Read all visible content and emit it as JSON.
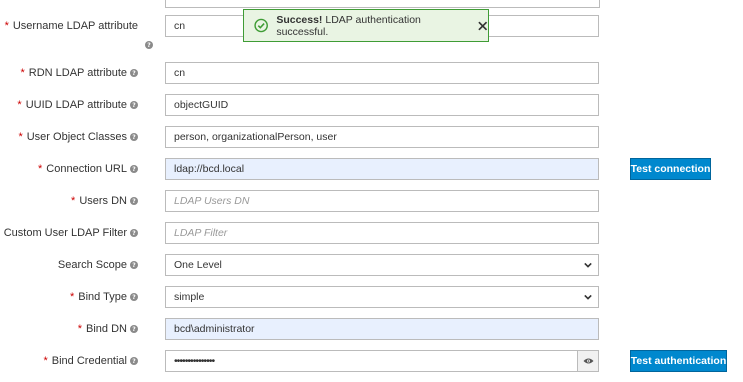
{
  "toast": {
    "title": "Success!",
    "message": "LDAP authentication successful."
  },
  "rows": [
    {
      "label": "Username LDAP attribute",
      "required": true,
      "value": "cn",
      "placeholder": ""
    },
    {
      "label": "RDN LDAP attribute",
      "required": true,
      "value": "cn",
      "placeholder": ""
    },
    {
      "label": "UUID LDAP attribute",
      "required": true,
      "value": "objectGUID",
      "placeholder": ""
    },
    {
      "label": "User Object Classes",
      "required": true,
      "value": "person, organizationalPerson, user",
      "placeholder": ""
    },
    {
      "label": "Connection URL",
      "required": true,
      "value": "ldap://bcd.local",
      "placeholder": ""
    },
    {
      "label": "Users DN",
      "required": true,
      "value": "",
      "placeholder": "LDAP Users DN"
    },
    {
      "label": "Custom User LDAP Filter",
      "required": false,
      "value": "",
      "placeholder": "LDAP Filter"
    },
    {
      "label": "Search Scope",
      "required": false,
      "value": "One Level",
      "placeholder": ""
    },
    {
      "label": "Bind Type",
      "required": true,
      "value": "simple",
      "placeholder": ""
    },
    {
      "label": "Bind DN",
      "required": true,
      "value": "bcd\\administrator",
      "placeholder": ""
    },
    {
      "label": "Bind Credential",
      "required": true,
      "value": "•••••••••••••••",
      "placeholder": ""
    }
  ],
  "buttons": {
    "test_connection": "Test connection",
    "test_authentication": "Test authentication"
  },
  "required_marker": "*",
  "icons": {
    "help": "question-circle-icon",
    "success": "check-circle-icon",
    "close": "close-icon",
    "dropdown": "chevron-down-icon",
    "show_password": "eye-icon"
  },
  "colors": {
    "primary": "#0088ce",
    "success_border": "#3f9c35",
    "required": "#cc0000",
    "autofill_bg": "#e8f0fe"
  }
}
